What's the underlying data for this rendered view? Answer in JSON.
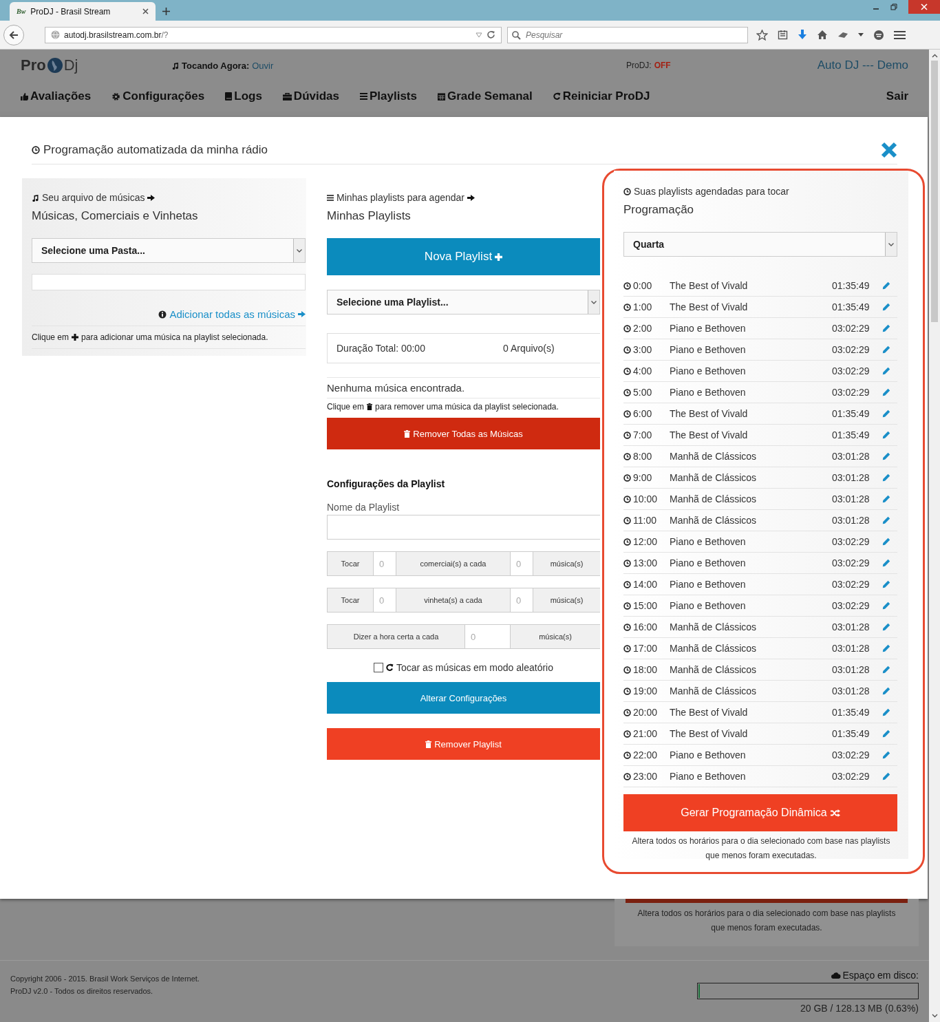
{
  "browser": {
    "favicon": "Bw",
    "tab_title": "ProDJ - Brasil Stream",
    "url_host": "autodj.brasilstream.com.br",
    "url_path": "/?",
    "search_placeholder": "Pesquisar"
  },
  "header": {
    "logo_left": "Pro",
    "logo_right": "Dj",
    "now_playing_label": "Tocando Agora:",
    "now_playing_link": "Ouvir",
    "status_label": "ProDJ:",
    "status_value": "OFF",
    "account": "Auto DJ --- Demo",
    "logout": "Sair",
    "nav": [
      "Avaliações",
      "Configurações",
      "Logs",
      "Dúvidas",
      "Playlists",
      "Grade Semanal",
      "Reiniciar ProDJ"
    ]
  },
  "modal": {
    "title": "Programação automatizada da minha rádio",
    "library": {
      "caption": "Seu arquivo de músicas",
      "heading": "Músicas, Comerciais e Vinhetas",
      "folder_select": "Selecione uma Pasta...",
      "add_all_link": "Adicionar todas as músicas",
      "hint_before": "Clique em",
      "hint_after": "para adicionar uma música na playlist selecionada."
    },
    "playlists": {
      "caption": "Minhas playlists para agendar",
      "heading": "Minhas Playlists",
      "new_button": "Nova Playlist",
      "playlist_select": "Selecione uma Playlist...",
      "total_duration": "Duração Total: 00:00",
      "file_count": "0 Arquivo(s)",
      "empty_message": "Nenhuma música encontrada.",
      "hint_before": "Clique em",
      "hint_after": "para remover uma música da playlist selecionada.",
      "remove_all_button": "Remover Todas as Músicas",
      "settings_heading": "Configurações da Playlist",
      "name_label": "Nome da Playlist",
      "commercials": {
        "play": "Tocar",
        "count": "0",
        "label": "comerciai(s) a cada",
        "every": "0",
        "unit": "música(s)"
      },
      "jingles": {
        "play": "Tocar",
        "count": "0",
        "label": "vinheta(s) a cada",
        "every": "0",
        "unit": "música(s)"
      },
      "time_announce": {
        "label": "Dizer a hora certa a cada",
        "every": "0",
        "unit": "música(s)"
      },
      "shuffle": {
        "label": "Tocar as músicas em modo aleatório",
        "checked": false
      },
      "save_button": "Alterar Configurações",
      "delete_button": "Remover Playlist"
    },
    "schedule": {
      "caption": "Suas playlists agendadas para tocar",
      "heading": "Programação",
      "day_select": "Quarta",
      "rows": [
        {
          "time": "0:00",
          "playlist": "The Best of Vivald",
          "duration": "01:35:49"
        },
        {
          "time": "1:00",
          "playlist": "The Best of Vivald",
          "duration": "01:35:49"
        },
        {
          "time": "2:00",
          "playlist": "Piano e Bethoven",
          "duration": "03:02:29"
        },
        {
          "time": "3:00",
          "playlist": "Piano e Bethoven",
          "duration": "03:02:29"
        },
        {
          "time": "4:00",
          "playlist": "Piano e Bethoven",
          "duration": "03:02:29"
        },
        {
          "time": "5:00",
          "playlist": "Piano e Bethoven",
          "duration": "03:02:29"
        },
        {
          "time": "6:00",
          "playlist": "The Best of Vivald",
          "duration": "01:35:49"
        },
        {
          "time": "7:00",
          "playlist": "The Best of Vivald",
          "duration": "01:35:49"
        },
        {
          "time": "8:00",
          "playlist": "Manhã de Clássicos",
          "duration": "03:01:28"
        },
        {
          "time": "9:00",
          "playlist": "Manhã de Clássicos",
          "duration": "03:01:28"
        },
        {
          "time": "10:00",
          "playlist": "Manhã de Clássicos",
          "duration": "03:01:28"
        },
        {
          "time": "11:00",
          "playlist": "Manhã de Clássicos",
          "duration": "03:01:28"
        },
        {
          "time": "12:00",
          "playlist": "Piano e Bethoven",
          "duration": "03:02:29"
        },
        {
          "time": "13:00",
          "playlist": "Piano e Bethoven",
          "duration": "03:02:29"
        },
        {
          "time": "14:00",
          "playlist": "Piano e Bethoven",
          "duration": "03:02:29"
        },
        {
          "time": "15:00",
          "playlist": "Piano e Bethoven",
          "duration": "03:02:29"
        },
        {
          "time": "16:00",
          "playlist": "Manhã de Clássicos",
          "duration": "03:01:28"
        },
        {
          "time": "17:00",
          "playlist": "Manhã de Clássicos",
          "duration": "03:01:28"
        },
        {
          "time": "18:00",
          "playlist": "Manhã de Clássicos",
          "duration": "03:01:28"
        },
        {
          "time": "19:00",
          "playlist": "Manhã de Clássicos",
          "duration": "03:01:28"
        },
        {
          "time": "20:00",
          "playlist": "The Best of Vivald",
          "duration": "01:35:49"
        },
        {
          "time": "21:00",
          "playlist": "The Best of Vivald",
          "duration": "01:35:49"
        },
        {
          "time": "22:00",
          "playlist": "Piano e Bethoven",
          "duration": "03:02:29"
        },
        {
          "time": "23:00",
          "playlist": "Piano e Bethoven",
          "duration": "03:02:29"
        }
      ],
      "generate_button": "Gerar Programação Dinâmica",
      "note": "Altera todos os horários para o dia selecionado com base nas playlists que menos foram executadas."
    }
  },
  "background": {
    "schedule_note": "Altera todos os horários para o dia selecionado com base nas playlists que menos foram executadas.",
    "copyright": "Copyright 2006 - 2015. Brasil Work Serviços de Internet.",
    "version": "ProDJ v2.0 - Todos os direitos reservados.",
    "disk": {
      "label": "Espaço em disco:",
      "level": 0.006,
      "reading": "20 GB / 128.13 MB (0.63%)"
    }
  }
}
